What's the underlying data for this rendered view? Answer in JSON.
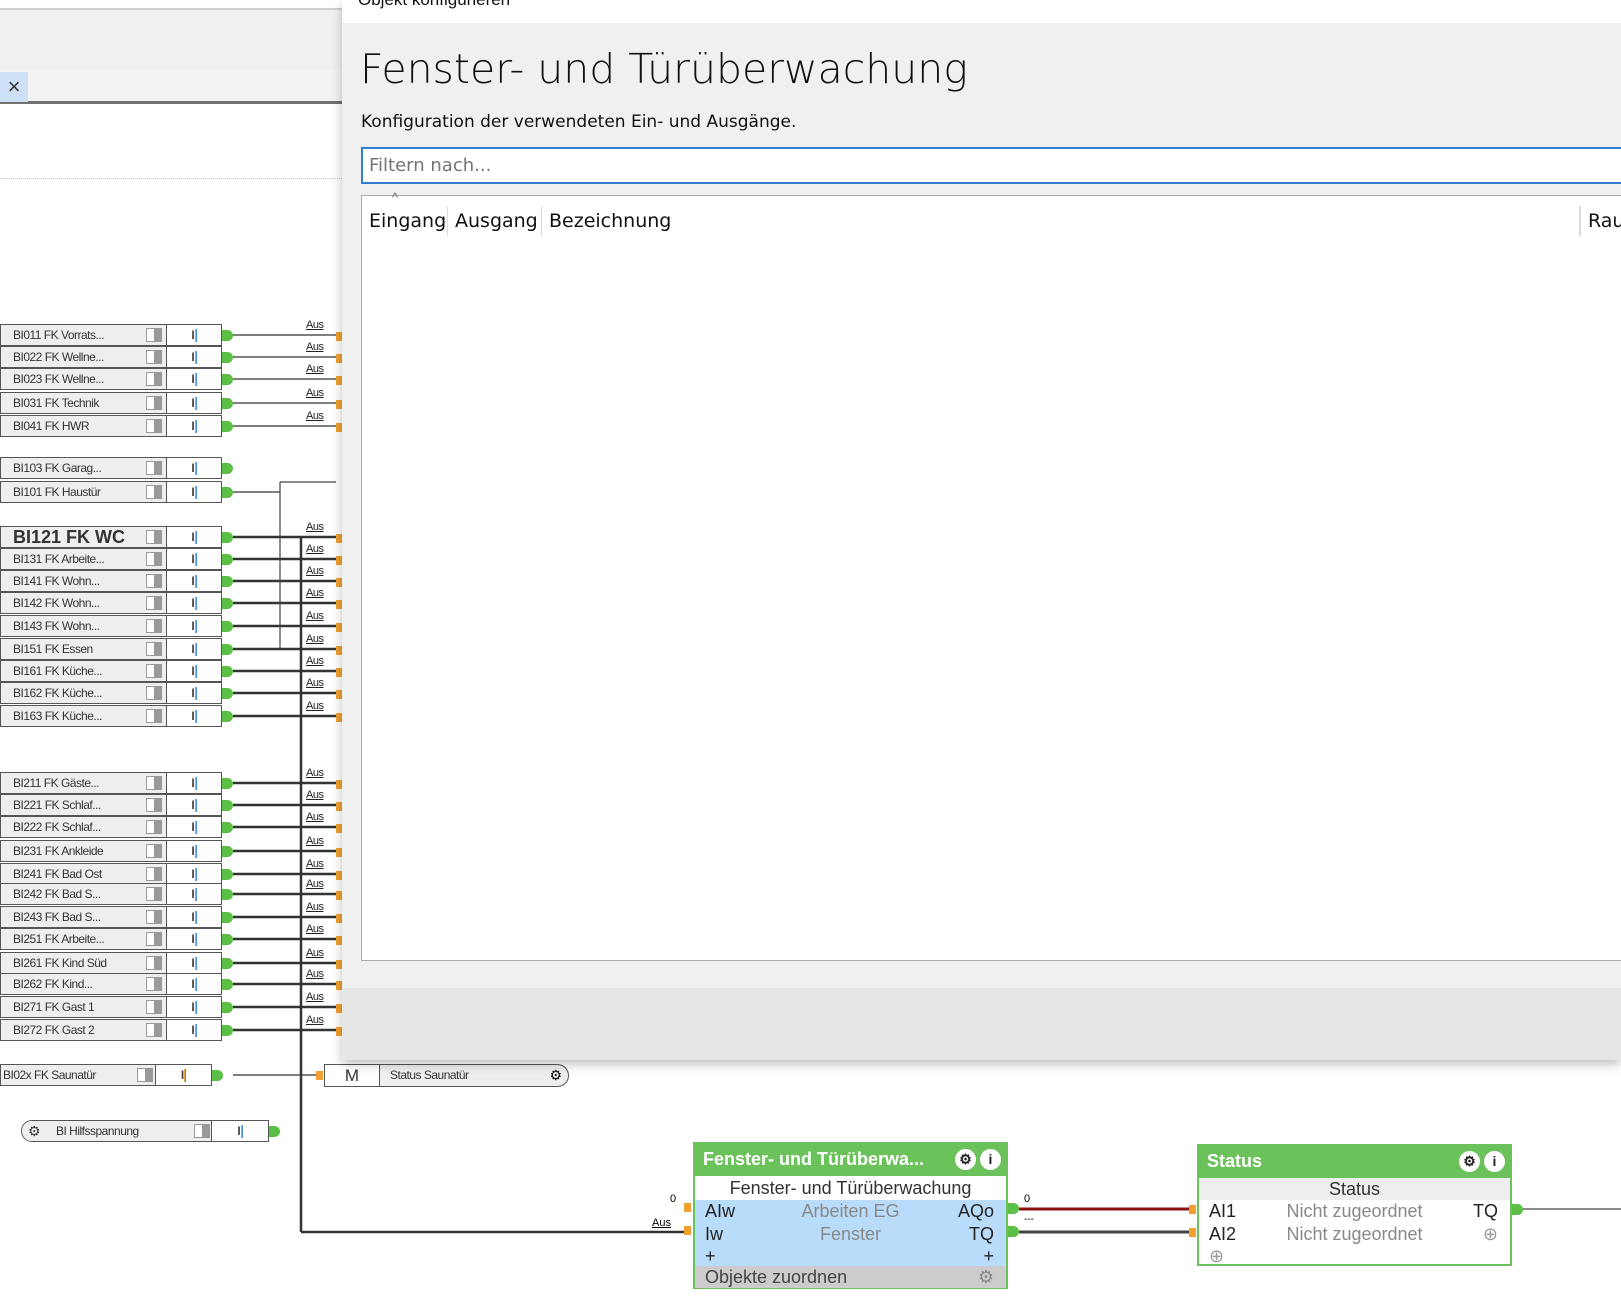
{
  "editor": {
    "tab_close": "×"
  },
  "rows": [
    {
      "label": "BI011  FK  Vorrats...",
      "value": "I",
      "wire": "Aus"
    },
    {
      "label": "BI022  FK  Wellne...",
      "value": "I",
      "wire": "Aus"
    },
    {
      "label": "BI023  FK  Wellne...",
      "value": "I",
      "wire": "Aus"
    },
    {
      "label": "BI031 FK Technik",
      "value": "I",
      "wire": "Aus"
    },
    {
      "label": "BI041 FK HWR",
      "value": "I",
      "wire": "Aus"
    },
    {
      "label": "BI103  FK  Garag...",
      "value": "I",
      "wire": ""
    },
    {
      "label": "BI101 FK Haustür",
      "value": "I",
      "wire": ""
    },
    {
      "label": "BI121 FK WC",
      "value": "I",
      "wire": "Aus",
      "emphasized": true
    },
    {
      "label": "BI131  FK  Arbeite...",
      "value": "I",
      "wire": "Aus"
    },
    {
      "label": "BI141  FK  Wohn...",
      "value": "I",
      "wire": "Aus"
    },
    {
      "label": "BI142  FK  Wohn...",
      "value": "I",
      "wire": "Aus"
    },
    {
      "label": "BI143  FK  Wohn...",
      "value": "I",
      "wire": "Aus"
    },
    {
      "label": "BI151 FK Essen",
      "value": "I",
      "wire": "Aus"
    },
    {
      "label": "BI161  FK  Küche...",
      "value": "I",
      "wire": "Aus"
    },
    {
      "label": "BI162  FK  Küche...",
      "value": "I",
      "wire": "Aus"
    },
    {
      "label": "BI163  FK  Küche...",
      "value": "I",
      "wire": "Aus"
    },
    {
      "label": "BI211  FK  Gäste...",
      "value": "I",
      "wire": "Aus"
    },
    {
      "label": "BI221  FK  Schlaf...",
      "value": "I",
      "wire": "Aus"
    },
    {
      "label": "BI222  FK  Schlaf...",
      "value": "I",
      "wire": "Aus"
    },
    {
      "label": "BI231 FK Ankleide",
      "value": "I",
      "wire": "Aus"
    },
    {
      "label": "BI241 FK Bad Ost",
      "value": "I",
      "wire": "Aus"
    },
    {
      "label": "BI242  FK  Bad  S...",
      "value": "I",
      "wire": "Aus"
    },
    {
      "label": "BI243  FK  Bad  S...",
      "value": "I",
      "wire": "Aus"
    },
    {
      "label": "BI251  FK  Arbeite...",
      "value": "I",
      "wire": "Aus"
    },
    {
      "label": "BI261 FK Kind Süd",
      "value": "I",
      "wire": "Aus"
    },
    {
      "label": "BI262  FK  Kind...",
      "value": "I",
      "wire": "Aus"
    },
    {
      "label": "BI271 FK Gast 1",
      "value": "I",
      "wire": "Aus"
    },
    {
      "label": "BI272 FK Gast 2",
      "value": "I",
      "wire": "Aus"
    }
  ],
  "sauna": {
    "label": "BI02x FK Saunatür",
    "value": "I",
    "marker": "M",
    "status": "Status Saunatür"
  },
  "hilfs": {
    "label": "BI Hilfsspannung",
    "value": "I"
  },
  "dialog": {
    "window_title": "Objekt konfigurieren",
    "heading": "Fenster- und Türüberwachung",
    "subtitle": "Konfiguration der verwendeten Ein- und Ausgänge.",
    "filter_placeholder": "Filtern nach...",
    "columns": [
      "Eingang",
      "Ausgang",
      "Bezeichnung",
      "Rau"
    ],
    "sort_indicator": "^"
  },
  "block_ftu": {
    "title": "Fenster- und Türüberwa...",
    "subtitle": "Fenster- und Türüberwachung",
    "ports": [
      {
        "in": "AIw",
        "name": "Arbeiten EG",
        "out": "AQo",
        "in_value": "0",
        "out_value": "0"
      },
      {
        "in": "Iw",
        "name": "Fenster",
        "out": "TQ",
        "in_value": "Aus",
        "out_value": "---"
      }
    ],
    "add": "+",
    "footer": "Objekte zuordnen"
  },
  "block_status": {
    "title": "Status",
    "subtitle": "Status",
    "ports": [
      {
        "in": "AI1",
        "name": "Nicht zugeordnet",
        "out": "TQ",
        "in_value": "0"
      },
      {
        "in": "AI2",
        "name": "Nicht zugeordnet",
        "out": "",
        "in_value": "---"
      }
    ]
  },
  "colors": {
    "block_green": "#6cc25a",
    "accent_blue": "#2f7fd4",
    "port_orange": "#f0a030",
    "wire_red": "#8b1010"
  }
}
